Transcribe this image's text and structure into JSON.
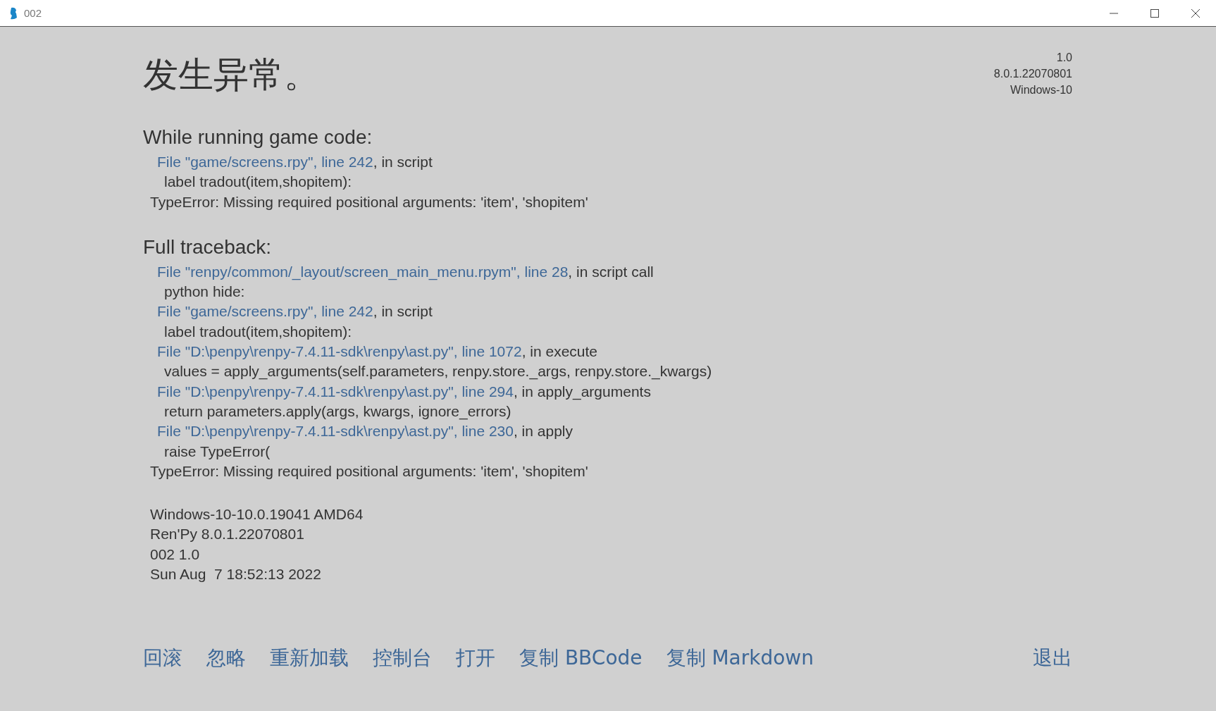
{
  "window": {
    "title": "002"
  },
  "title": "发生异常。",
  "version_info": [
    "1.0",
    "8.0.1.22070801",
    "Windows-10"
  ],
  "sections": [
    {
      "heading": "While running game code:",
      "lines": [
        {
          "kind": "frame",
          "link": "File \"game/screens.rpy\", line 242",
          "rest": ", in script"
        },
        {
          "kind": "code",
          "text": "label tradout(item,shopitem):"
        },
        {
          "kind": "error",
          "text": "TypeError: Missing required positional arguments: 'item', 'shopitem'"
        }
      ]
    },
    {
      "heading": "Full traceback:",
      "lines": [
        {
          "kind": "frame",
          "link": "File \"renpy/common/_layout/screen_main_menu.rpym\", line 28",
          "rest": ", in script call"
        },
        {
          "kind": "code",
          "text": "python hide:"
        },
        {
          "kind": "frame",
          "link": "File \"game/screens.rpy\", line 242",
          "rest": ", in script"
        },
        {
          "kind": "code",
          "text": "label tradout(item,shopitem):"
        },
        {
          "kind": "frame",
          "link": "File \"D:\\penpy\\renpy-7.4.11-sdk\\renpy\\ast.py\", line 1072",
          "rest": ", in execute"
        },
        {
          "kind": "code",
          "text": "values = apply_arguments(self.parameters, renpy.store._args, renpy.store._kwargs)"
        },
        {
          "kind": "frame",
          "link": "File \"D:\\penpy\\renpy-7.4.11-sdk\\renpy\\ast.py\", line 294",
          "rest": ", in apply_arguments"
        },
        {
          "kind": "code",
          "text": "return parameters.apply(args, kwargs, ignore_errors)"
        },
        {
          "kind": "frame",
          "link": "File \"D:\\penpy\\renpy-7.4.11-sdk\\renpy\\ast.py\", line 230",
          "rest": ", in apply"
        },
        {
          "kind": "code",
          "text": "raise TypeError("
        },
        {
          "kind": "error",
          "text": "TypeError: Missing required positional arguments: 'item', 'shopitem'"
        }
      ]
    }
  ],
  "system_info": [
    "Windows-10-10.0.19041 AMD64",
    "Ren'Py 8.0.1.22070801",
    "002 1.0",
    "Sun Aug  7 18:52:13 2022"
  ],
  "buttons": [
    {
      "label": "回滚"
    },
    {
      "label": "忽略"
    },
    {
      "label": "重新加载"
    },
    {
      "label": "控制台"
    },
    {
      "label": "打开"
    },
    {
      "label": "复制 BBCode"
    },
    {
      "label": "复制 Markdown"
    }
  ],
  "quit_button": {
    "label": "退出"
  }
}
